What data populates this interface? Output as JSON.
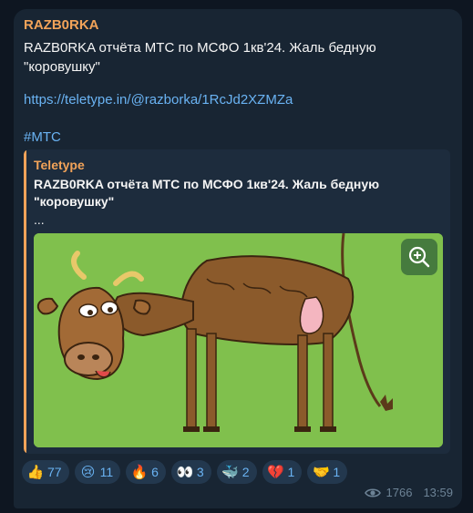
{
  "post": {
    "channel": "RAZB0RKA",
    "text_line1": "RAZB0RKA отчёта МТС по МСФО 1кв'24. Жаль бедную",
    "text_line2": "\"коровушку\"",
    "link": "https://teletype.in/@razborka/1RcJd2XZMZa",
    "hashtag": "#МТС"
  },
  "preview": {
    "site": "Teletype",
    "title_line1": "RAZB0RKA отчёта МТС по МСФО 1кв'24. Жаль бедную",
    "title_line2": "\"коровушку\"",
    "ellipsis": "...",
    "image_icon": "zoom-in-icon"
  },
  "reactions": [
    {
      "icon": "thumbs-up",
      "emoji": "👍",
      "count": "77"
    },
    {
      "icon": "crying-face",
      "emoji": "😢",
      "count": "11"
    },
    {
      "icon": "fire",
      "emoji": "🔥",
      "count": "6"
    },
    {
      "icon": "eyes",
      "emoji": "👀",
      "count": "3"
    },
    {
      "icon": "whale",
      "emoji": "🐳",
      "count": "2"
    },
    {
      "icon": "broken-heart",
      "emoji": "💔",
      "count": "1"
    },
    {
      "icon": "handshake",
      "emoji": "🤝",
      "count": "1"
    }
  ],
  "meta": {
    "views": "1766",
    "time": "13:59"
  },
  "colors": {
    "background": "#0e1621",
    "bubble": "#182533",
    "accent_orange": "#f2a359",
    "link_blue": "#6ab3f3"
  }
}
